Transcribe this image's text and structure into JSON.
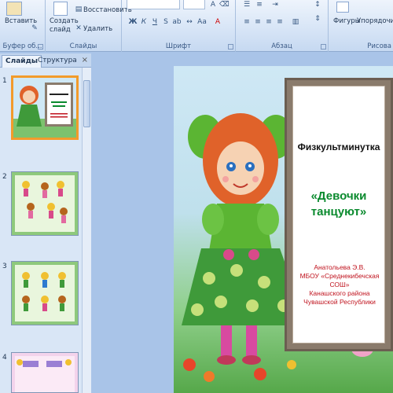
{
  "ribbon": {
    "clipboard": {
      "paste_label": "Вставить",
      "group_label": "Буфер об..."
    },
    "slides": {
      "new_slide_label": "Создать слайд",
      "reset_label": "Восстановить",
      "delete_label": "Удалить",
      "group_label": "Слайды"
    },
    "font": {
      "group_label": "Шрифт"
    },
    "paragraph": {
      "group_label": "Абзац"
    },
    "drawing": {
      "shapes_label": "Фигуры",
      "arrange_label": "Упорядочить",
      "group_label": "Рисова"
    }
  },
  "panel": {
    "tabs": [
      "Слайды",
      "Структура"
    ],
    "close_label": "×",
    "slide_numbers": [
      "1",
      "2",
      "3",
      "4"
    ]
  },
  "slide": {
    "title": "Физкультминутка",
    "subtitle_line1": "«Девочки",
    "subtitle_line2": "танцуют»",
    "author_lines": [
      "Анатольева Э.В.",
      "МБОУ «Среднекибечская СОШ»",
      "Канашского района",
      "Чувашской Республики"
    ]
  }
}
